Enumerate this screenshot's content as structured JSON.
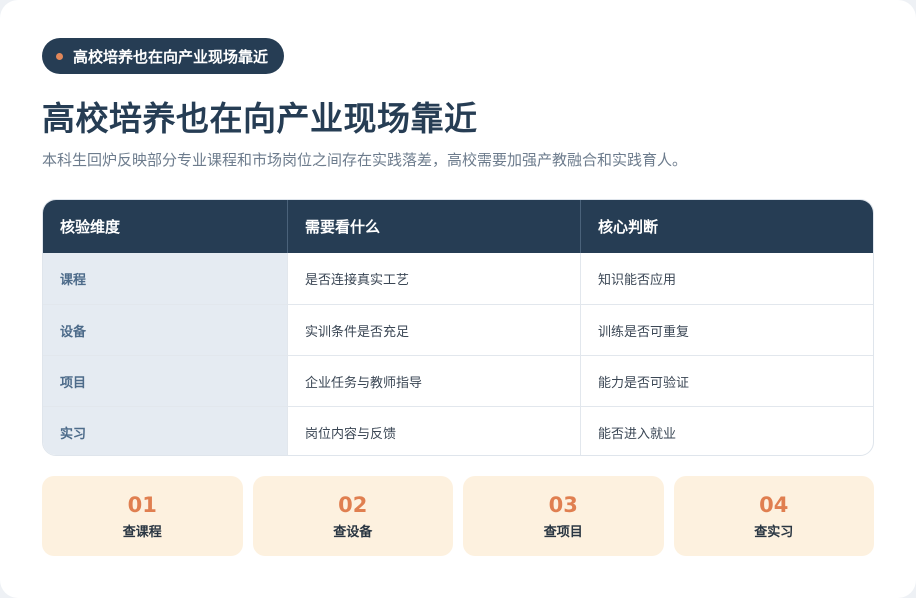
{
  "tag": {
    "label": "高校培养也在向产业现场靠近"
  },
  "header": {
    "title": "高校培养也在向产业现场靠近",
    "subtitle": "本科生回炉反映部分专业课程和市场岗位之间存在实践落差，高校需要加强产教融合和实践育人。"
  },
  "table": {
    "columns": [
      "核验维度",
      "需要看什么",
      "核心判断"
    ],
    "rows": [
      [
        "课程",
        "是否连接真实工艺",
        "知识能否应用"
      ],
      [
        "设备",
        "实训条件是否充足",
        "训练是否可重复"
      ],
      [
        "项目",
        "企业任务与教师指导",
        "能力是否可验证"
      ],
      [
        "实习",
        "岗位内容与反馈",
        "能否进入就业"
      ]
    ]
  },
  "steps": [
    {
      "num": "01",
      "label": "查课程"
    },
    {
      "num": "02",
      "label": "查设备"
    },
    {
      "num": "03",
      "label": "查项目"
    },
    {
      "num": "04",
      "label": "查实习"
    }
  ],
  "colors": {
    "navy": "#263d54",
    "accent": "#e07f50",
    "step_bg": "#fdf1df",
    "first_col_bg": "#e5ebf2"
  }
}
